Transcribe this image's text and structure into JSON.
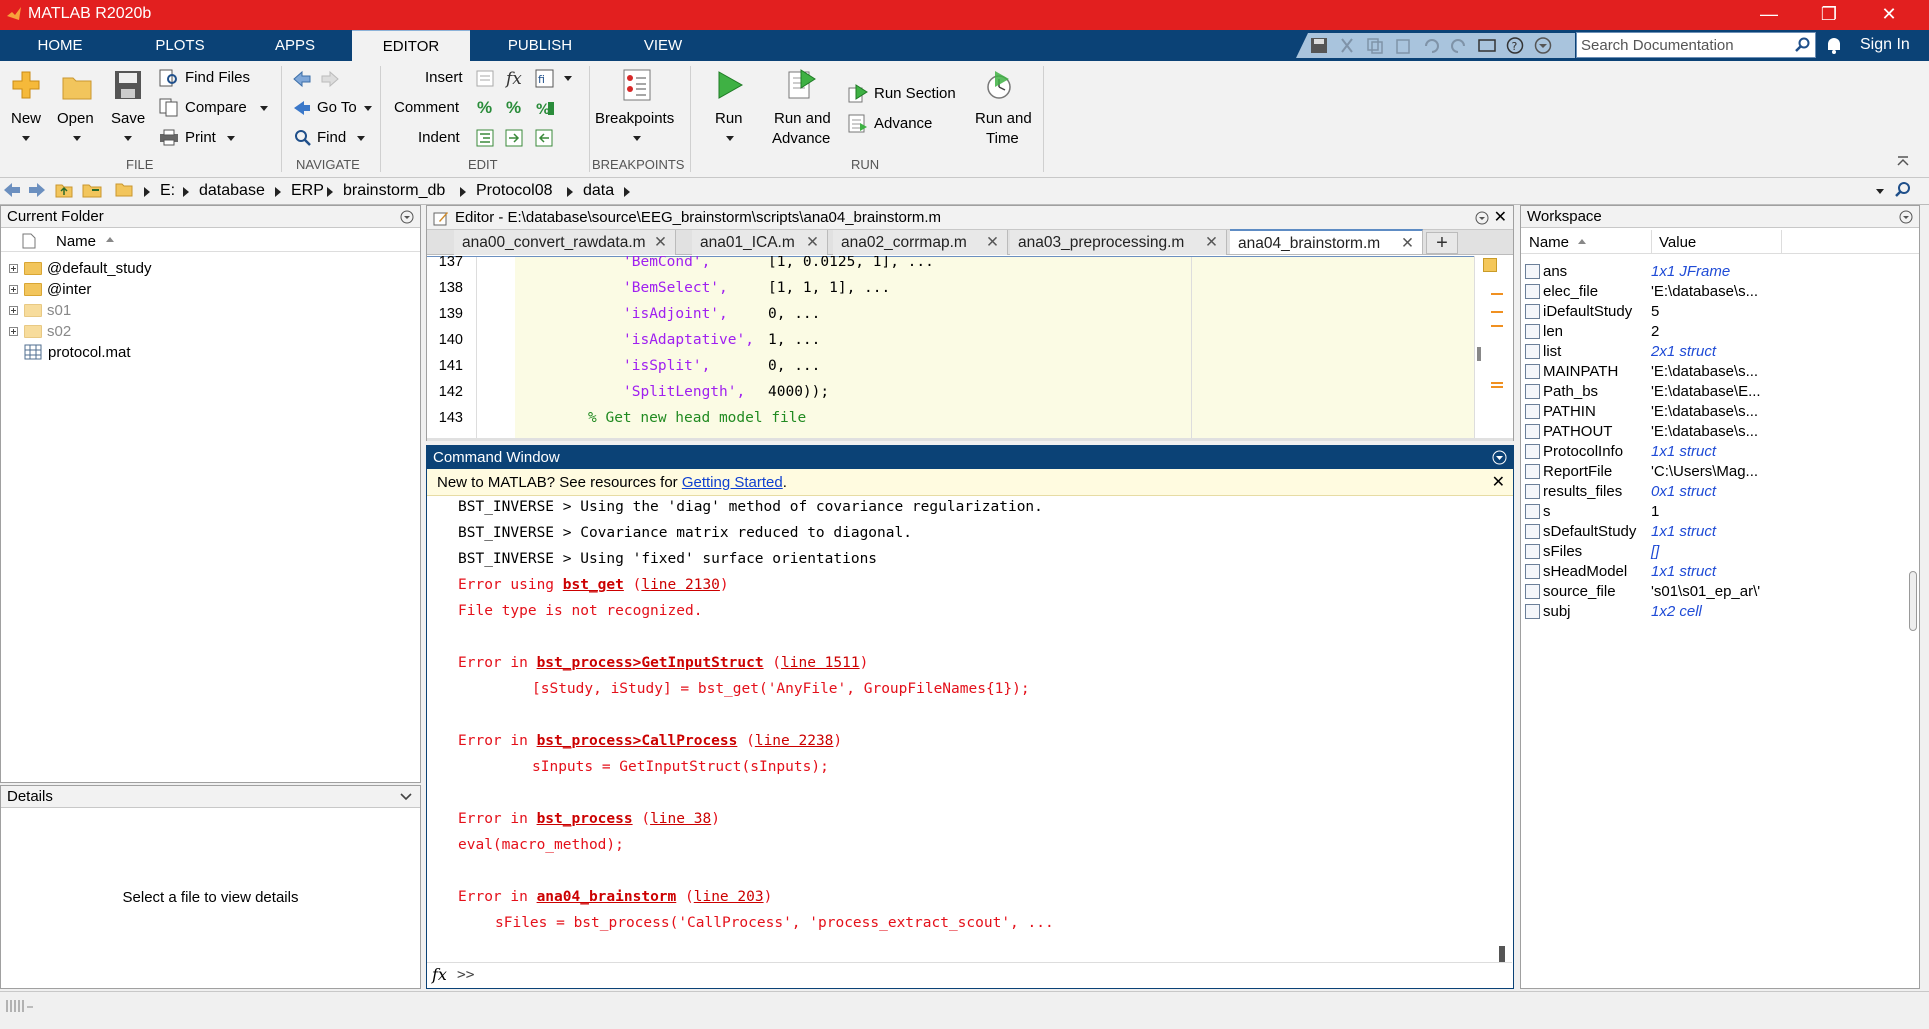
{
  "window": {
    "title": "MATLAB R2020b"
  },
  "ribbon_tabs": [
    "HOME",
    "PLOTS",
    "APPS",
    "EDITOR",
    "PUBLISH",
    "VIEW"
  ],
  "search": {
    "placeholder": "Search Documentation"
  },
  "signin_label": "Sign In",
  "ribbon": {
    "file": {
      "new": "New",
      "open": "Open",
      "save": "Save",
      "find_files": "Find Files",
      "compare": "Compare",
      "print": "Print",
      "group": "FILE"
    },
    "navigate": {
      "goto": "Go To",
      "find": "Find",
      "group": "NAVIGATE"
    },
    "edit": {
      "insert": "Insert",
      "comment": "Comment",
      "indent": "Indent",
      "group": "EDIT"
    },
    "breakpoints": {
      "label": "Breakpoints",
      "group": "BREAKPOINTS"
    },
    "run": {
      "run": "Run",
      "run_advance_1": "Run and",
      "run_advance_2": "Advance",
      "run_section": "Run Section",
      "advance": "Advance",
      "run_time_1": "Run and",
      "run_time_2": "Time",
      "group": "RUN"
    }
  },
  "address": {
    "crumbs": [
      "E:",
      "database",
      "ERP",
      "brainstorm_db",
      "Protocol08",
      "data"
    ]
  },
  "current_folder": {
    "title": "Current Folder",
    "col_name": "Name",
    "items": [
      {
        "name": "@default_study",
        "type": "folder",
        "expandable": true
      },
      {
        "name": "@inter",
        "type": "folder",
        "expandable": true
      },
      {
        "name": "s01",
        "type": "folder",
        "expandable": true
      },
      {
        "name": "s02",
        "type": "folder",
        "expandable": true
      },
      {
        "name": "protocol.mat",
        "type": "mat",
        "expandable": false
      }
    ]
  },
  "details": {
    "title": "Details",
    "placeholder": "Select a file to view details"
  },
  "editor": {
    "title": "Editor - E:\\database\\source\\EEG_brainstorm\\scripts\\ana04_brainstorm.m",
    "tabs": [
      "ana00_convert_rawdata.m",
      "ana01_ICA.m",
      "ana02_corrmap.m",
      "ana03_preprocessing.m",
      "ana04_brainstorm.m"
    ],
    "active_tab": "ana04_brainstorm.m",
    "lines": [
      {
        "num": "137",
        "str": "'BemCond',",
        "rest": "[1, 0.0125, 1], ..."
      },
      {
        "num": "138",
        "str": "'BemSelect',",
        "rest": "[1, 1, 1], ..."
      },
      {
        "num": "139",
        "str": "'isAdjoint',",
        "rest": "0, ..."
      },
      {
        "num": "140",
        "str": "'isAdaptative',",
        "rest": "1, ..."
      },
      {
        "num": "141",
        "str": "'isSplit',",
        "rest": "0, ..."
      },
      {
        "num": "142",
        "str": "'SplitLength',",
        "rest": "4000));"
      },
      {
        "num": "143",
        "comment": "% Get new head model file"
      }
    ]
  },
  "command_window": {
    "title": "Command Window",
    "banner_text": "New to MATLAB? See resources for ",
    "banner_link": "Getting Started",
    "banner_end": ".",
    "lines": {
      "l1": "BST_INVERSE > Using the 'diag' method of covariance regularization.",
      "l2": "BST_INVERSE > Covariance matrix reduced to diagonal.",
      "l3": "BST_INVERSE > Using 'fixed' surface orientations",
      "e1_prefix": "Error using ",
      "e1_func": "bst_get",
      "e1_line": "line 2130",
      "e1_msg": "File type is not recognized.",
      "e2_prefix": "Error in ",
      "e2_func": "bst_process>GetInputStruct",
      "e2_line": "line 1511",
      "e2_code": "[sStudy, iStudy] = bst_get('AnyFile', GroupFileNames{1});",
      "e3_func": "bst_process>CallProcess",
      "e3_line": "line 2238",
      "e3_code": "sInputs = GetInputStruct(sInputs);",
      "e4_func": "bst_process",
      "e4_line": "line 38",
      "e4_code": "eval(macro_method);",
      "e5_func": "ana04_brainstorm",
      "e5_line": "line 203",
      "e5_code": "sFiles = bst_process('CallProcess', 'process_extract_scout', ...",
      "prompt": ">>"
    }
  },
  "workspace": {
    "title": "Workspace",
    "col_name": "Name",
    "col_value": "Value",
    "vars": [
      {
        "name": "ans",
        "value": "1x1 JFrame",
        "italic": true,
        "icon": "object"
      },
      {
        "name": "elec_file",
        "value": "'E:\\database\\s...",
        "italic": false,
        "icon": "char"
      },
      {
        "name": "iDefaultStudy",
        "value": "5",
        "italic": false,
        "icon": "numeric"
      },
      {
        "name": "len",
        "value": "2",
        "italic": false,
        "icon": "numeric"
      },
      {
        "name": "list",
        "value": "2x1 struct",
        "italic": true,
        "icon": "struct"
      },
      {
        "name": "MAINPATH",
        "value": "'E:\\database\\s...",
        "italic": false,
        "icon": "char"
      },
      {
        "name": "Path_bs",
        "value": "'E:\\database\\E...",
        "italic": false,
        "icon": "char"
      },
      {
        "name": "PATHIN",
        "value": "'E:\\database\\s...",
        "italic": false,
        "icon": "char"
      },
      {
        "name": "PATHOUT",
        "value": "'E:\\database\\s...",
        "italic": false,
        "icon": "char"
      },
      {
        "name": "ProtocolInfo",
        "value": "1x1 struct",
        "italic": true,
        "icon": "struct"
      },
      {
        "name": "ReportFile",
        "value": "'C:\\Users\\Mag...",
        "italic": false,
        "icon": "char"
      },
      {
        "name": "results_files",
        "value": "0x1 struct",
        "italic": true,
        "icon": "struct"
      },
      {
        "name": "s",
        "value": "1",
        "italic": false,
        "icon": "numeric"
      },
      {
        "name": "sDefaultStudy",
        "value": "1x1 struct",
        "italic": true,
        "icon": "struct"
      },
      {
        "name": "sFiles",
        "value": "[]",
        "italic": true,
        "icon": "struct"
      },
      {
        "name": "sHeadModel",
        "value": "1x1 struct",
        "italic": true,
        "icon": "struct"
      },
      {
        "name": "source_file",
        "value": "'s01\\s01_ep_ar\\'",
        "italic": false,
        "icon": "char"
      },
      {
        "name": "subj",
        "value": "1x2 cell",
        "italic": true,
        "icon": "cell"
      }
    ]
  },
  "colors": {
    "titlebar": "#e21f1f",
    "ribbon_tabs": "#0b4276",
    "cmd_header": "#0b4276",
    "error": "#e4101a",
    "string": "#a020f0",
    "comment": "#228b22"
  }
}
